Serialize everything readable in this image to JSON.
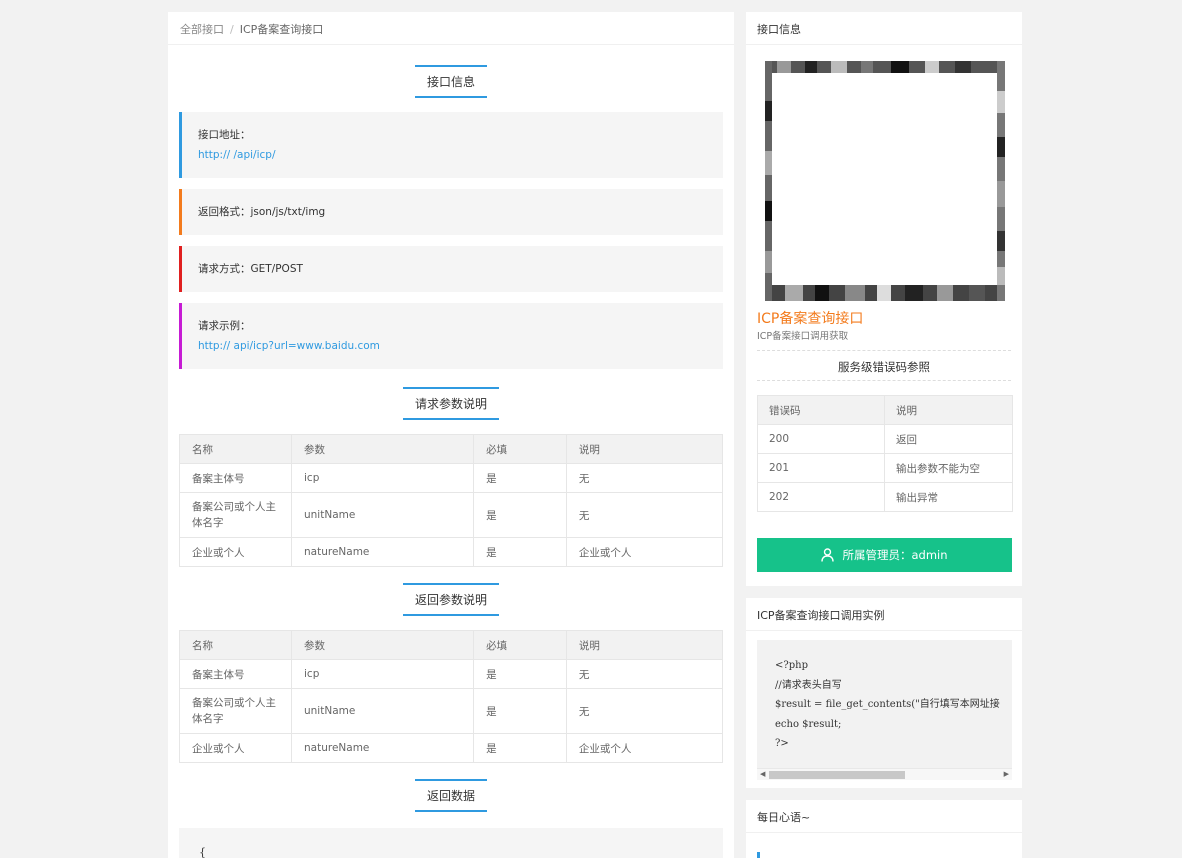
{
  "breadcrumb": {
    "root": "全部接口",
    "sep": "/",
    "current": "ICP备案查询接口"
  },
  "sections": {
    "info": "接口信息",
    "req_params": "请求参数说明",
    "ret_params": "返回参数说明",
    "ret_data": "返回数据"
  },
  "info": {
    "url_label": "接口地址：",
    "url_value": "http://          /api/icp/",
    "format": "返回格式：json/js/txt/img",
    "method": "请求方式：GET/POST",
    "example_label": "请求示例：",
    "example_value": "http://          api/icp?url=www.baidu.com"
  },
  "params_table": {
    "headers": [
      "名称",
      "参数",
      "必填",
      "说明"
    ],
    "rows": [
      [
        "备案主体号",
        "icp",
        "是",
        "无"
      ],
      [
        "备案公司或个人主体名字",
        "unitName",
        "是",
        "无"
      ],
      [
        "企业或个人",
        "natureName",
        "是",
        "企业或个人"
      ]
    ]
  },
  "return_table": {
    "headers": [
      "名称",
      "参数",
      "必填",
      "说明"
    ],
    "rows": [
      [
        "备案主体号",
        "icp",
        "是",
        "无"
      ],
      [
        "备案公司或个人主体名字",
        "unitName",
        "是",
        "无"
      ],
      [
        "企业或个人",
        "natureName",
        "是",
        "企业或个人"
      ]
    ]
  },
  "return_code": "{",
  "side1": {
    "title": "接口信息",
    "api_title": "ICP备案查询接口",
    "api_desc": "ICP备案接口调用获取",
    "err_title": "服务级错误码参照",
    "err_headers": [
      "错误码",
      "说明"
    ],
    "err_rows": [
      [
        "200",
        "返回"
      ],
      [
        "201",
        "输出参数不能为空"
      ],
      [
        "202",
        "输出异常"
      ]
    ],
    "admin": "所属管理员：admin"
  },
  "side2": {
    "title": "ICP备案查询接口调用实例",
    "code": "<?php\n//请求表头自写\n$result = file_get_contents(\"自行填写本网址接\necho $result;\n?>"
  },
  "side3": {
    "title": "每日心语~"
  },
  "colors": {
    "accent": "#2f9ae0",
    "green": "#16c28a",
    "orange": "#f37b1d"
  }
}
